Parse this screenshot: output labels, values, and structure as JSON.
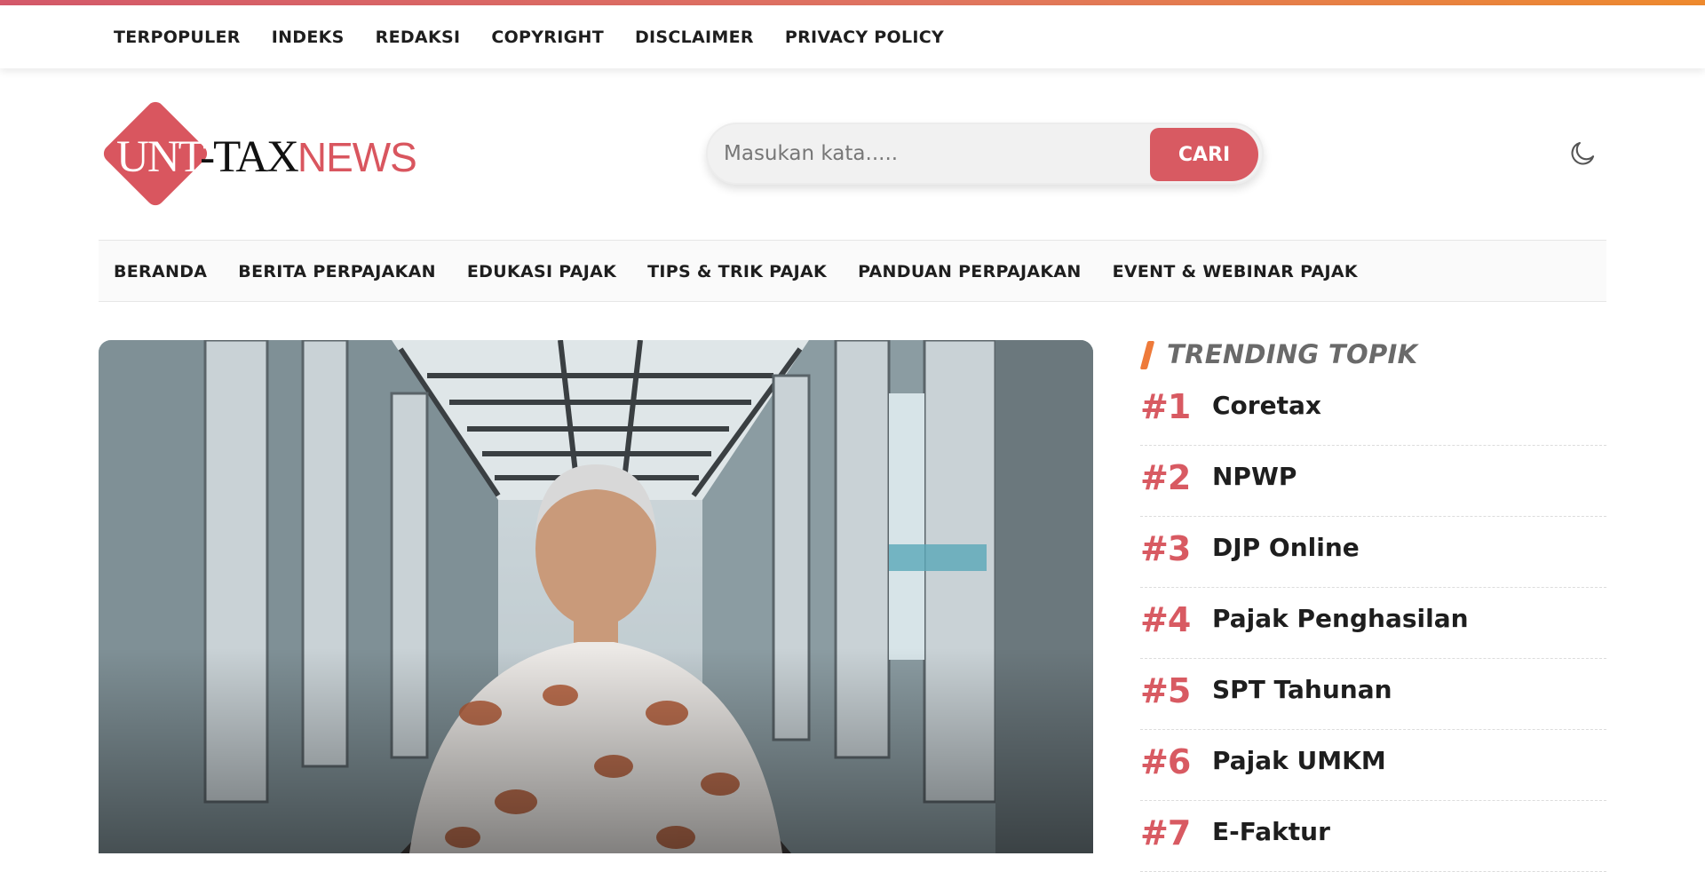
{
  "brand": {
    "accent_color": "#d85a62",
    "gradient_end": "#ee8a2e",
    "logo": {
      "part1": "UNT",
      "part2": "-TAX",
      "part3": "NEWS"
    }
  },
  "topbar": {
    "items": [
      {
        "label": "TERPOPULER"
      },
      {
        "label": "INDEKS"
      },
      {
        "label": "REDAKSI"
      },
      {
        "label": "COPYRIGHT"
      },
      {
        "label": "DISCLAIMER"
      },
      {
        "label": "PRIVACY POLICY"
      }
    ]
  },
  "search": {
    "placeholder": "Masukan kata.....",
    "value": "",
    "button_label": "CARI"
  },
  "theme_toggle": {
    "icon": "moon-icon"
  },
  "mainnav": {
    "items": [
      {
        "label": "BERANDA"
      },
      {
        "label": "BERITA PERPAJAKAN"
      },
      {
        "label": "EDUKASI PAJAK"
      },
      {
        "label": "TIPS & TRIK PAJAK"
      },
      {
        "label": "PANDUAN PERPAJAKAN"
      },
      {
        "label": "EVENT & WEBINAR PAJAK"
      }
    ]
  },
  "hero": {
    "icon": "featured-article-photo"
  },
  "trending": {
    "title": "TRENDING TOPIK",
    "items": [
      {
        "rank": "#1",
        "label": "Coretax"
      },
      {
        "rank": "#2",
        "label": "NPWP"
      },
      {
        "rank": "#3",
        "label": "DJP Online"
      },
      {
        "rank": "#4",
        "label": "Pajak Penghasilan"
      },
      {
        "rank": "#5",
        "label": "SPT Tahunan"
      },
      {
        "rank": "#6",
        "label": "Pajak UMKM"
      },
      {
        "rank": "#7",
        "label": "E-Faktur"
      }
    ]
  }
}
